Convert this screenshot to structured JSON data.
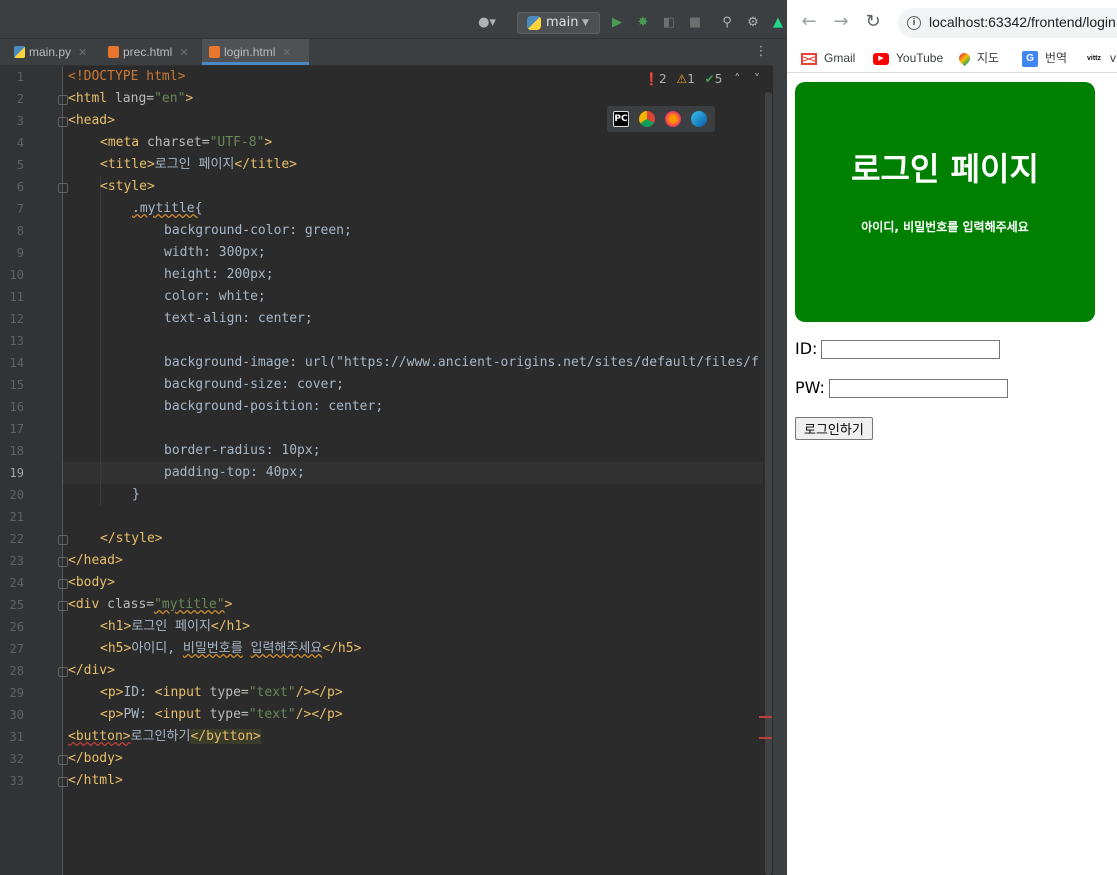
{
  "ide": {
    "run_config": "main",
    "tabs": [
      {
        "label": "main.py",
        "active": false
      },
      {
        "label": "prec.html",
        "active": false
      },
      {
        "label": "login.html",
        "active": true
      }
    ],
    "inspections": {
      "errors": "2",
      "warnings": "1",
      "typos": "5"
    },
    "current_line": 19,
    "line_numbers": [
      "1",
      "2",
      "3",
      "4",
      "5",
      "6",
      "7",
      "8",
      "9",
      "10",
      "11",
      "12",
      "13",
      "14",
      "15",
      "16",
      "17",
      "18",
      "19",
      "20",
      "21",
      "22",
      "23",
      "24",
      "25",
      "26",
      "27",
      "28",
      "29",
      "30",
      "31",
      "32",
      "33"
    ],
    "code": {
      "l1": "<!DOCTYPE html>",
      "l2_tag": "<html",
      "l2_attr": " lang=",
      "l2_val": "\"en\"",
      "l2_end": ">",
      "l3": "<head>",
      "l4_tag": "<meta",
      "l4_attr": " charset=",
      "l4_val": "\"UTF-8\"",
      "l4_end": ">",
      "l5_open": "<title>",
      "l5_text": "로그인 페이지",
      "l5_close": "</title>",
      "l6": "<style>",
      "l7": ".mytitle{",
      "l8": "background-color: green;",
      "l9": "width: 300px;",
      "l10": "height: 200px;",
      "l11": "color: white;",
      "l12": "text-align: center;",
      "l14": "background-image: url(\"https://www.ancient-origins.net/sites/default/files/f",
      "l15": "background-size: cover;",
      "l16": "background-position: center;",
      "l18": "border-radius: 10px;",
      "l19": "padding-top: 40px;",
      "l20": "}",
      "l22": "</style>",
      "l23": "</head>",
      "l24": "<body>",
      "l25_tag": "<div",
      "l25_attr": " class=",
      "l25_val": "\"mytitle\"",
      "l25_end": ">",
      "l26_open": "<h1>",
      "l26_text": "로그인 페이지",
      "l26_close": "</h1>",
      "l27_open": "<h5>",
      "l27_text1": "아이디, ",
      "l27_text2": "비밀번호를",
      "l27_text3": " ",
      "l27_text4": "입력해주세요",
      "l27_close": "</h5>",
      "l28": "</div>",
      "l29_p": "<p>",
      "l29_label": "ID: ",
      "l29_tag": "<input",
      "l29_attr": " type=",
      "l29_val": "\"text\"",
      "l29_end": "/></p>",
      "l30_p": "<p>",
      "l30_label": "PW: ",
      "l30_tag": "<input",
      "l30_attr": " type=",
      "l30_val": "\"text\"",
      "l30_end": "/></p>",
      "l31_open": "<button>",
      "l31_text": "로그인하기",
      "l31_close": "</bytton>",
      "l32": "</body>",
      "l33": "</html>"
    }
  },
  "browser": {
    "url": "localhost:63342/frontend/login",
    "bookmarks": [
      {
        "label": "Gmail",
        "icon": "gmail-icon"
      },
      {
        "label": "YouTube",
        "icon": "youtube-icon"
      },
      {
        "label": "지도",
        "icon": "maps-icon"
      },
      {
        "label": "번역",
        "icon": "translate-icon"
      },
      {
        "label": "v",
        "icon": "vittz-icon"
      }
    ],
    "page": {
      "h1": "로그인 페이지",
      "h5": "아이디, 비밀번호를 입력해주세요",
      "id_label": "ID:",
      "pw_label": "PW:",
      "button": "로그인하기",
      "box_color": "#008000"
    }
  }
}
